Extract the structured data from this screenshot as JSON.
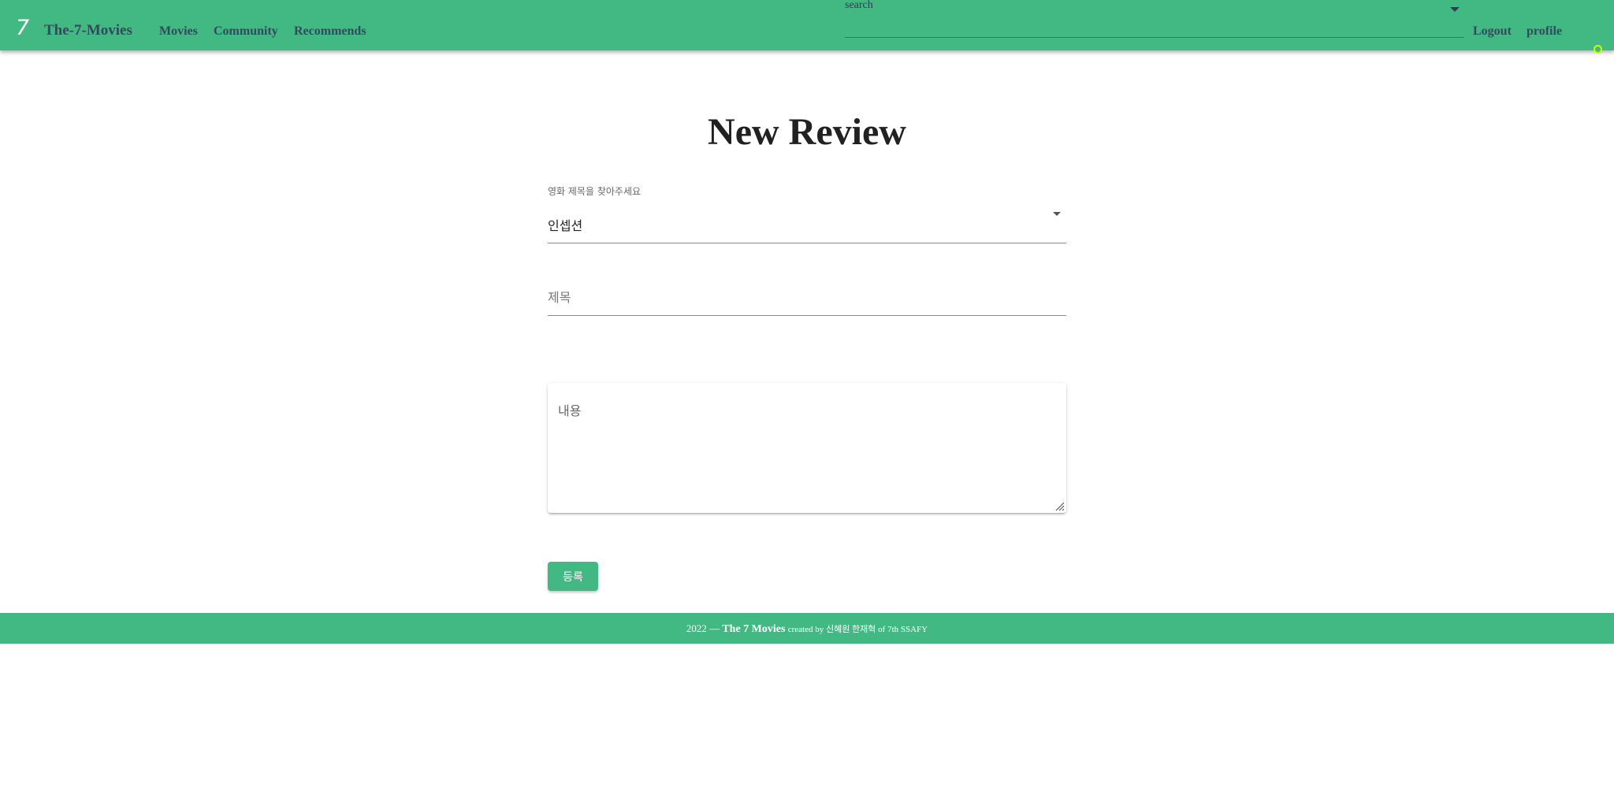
{
  "header": {
    "logo_text": "7",
    "brand": "The-7-Movies",
    "nav": {
      "movies": "Movies",
      "community": "Community",
      "recommends": "Recommends",
      "logout": "Logout",
      "profile": "profile"
    },
    "search": {
      "label": "search",
      "value": ""
    }
  },
  "page": {
    "title": "New Review"
  },
  "form": {
    "movie_select": {
      "label": "영화 제목을 찾아주세요",
      "value": "인셉션"
    },
    "title_field": {
      "placeholder": "제목",
      "value": ""
    },
    "content_field": {
      "placeholder": "내용",
      "value": ""
    },
    "submit_label": "등록"
  },
  "footer": {
    "year": "2022 —",
    "brand": "The 7 Movies",
    "credit": "created by 신혜원 한재혁 of 7th SSAFY"
  },
  "colors": {
    "primary": "#42b883",
    "nav_text": "#34495e",
    "status_ring": "#c6ff00"
  }
}
